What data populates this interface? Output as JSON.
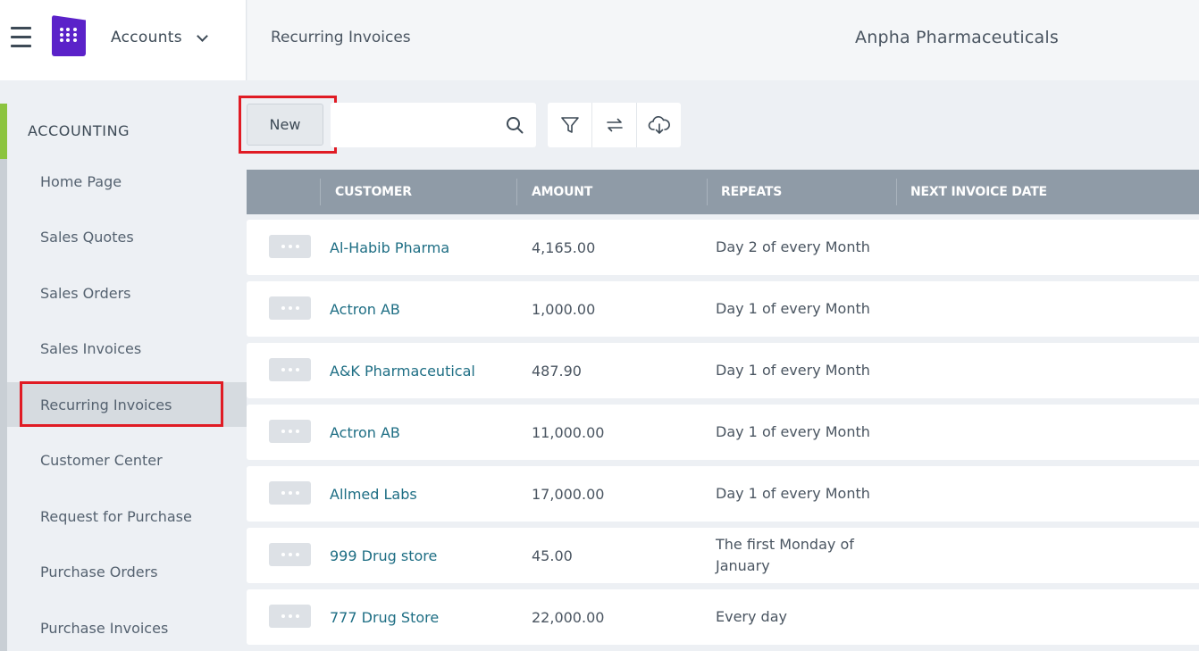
{
  "header": {
    "app_name": "Accounts",
    "page_title": "Recurring Invoices",
    "company": "Anpha Pharmaceuticals"
  },
  "sidebar": {
    "section": "ACCOUNTING",
    "items": [
      {
        "label": "Home Page"
      },
      {
        "label": "Sales Quotes"
      },
      {
        "label": "Sales Orders"
      },
      {
        "label": "Sales Invoices"
      },
      {
        "label": "Recurring Invoices",
        "active": true
      },
      {
        "label": "Customer Center"
      },
      {
        "label": "Request for Purchase"
      },
      {
        "label": "Purchase Orders"
      },
      {
        "label": "Purchase Invoices"
      }
    ]
  },
  "toolbar": {
    "new_label": "New",
    "search_placeholder": "",
    "search_value": ""
  },
  "table": {
    "columns": [
      "CUSTOMER",
      "AMOUNT",
      "REPEATS",
      "NEXT INVOICE DATE"
    ],
    "rows": [
      {
        "customer": "Al-Habib Pharma",
        "amount": "4,165.00",
        "repeats": "Day 2 of every Month",
        "next_invoice_date": ""
      },
      {
        "customer": "Actron AB",
        "amount": "1,000.00",
        "repeats": "Day 1 of every Month",
        "next_invoice_date": ""
      },
      {
        "customer": "A&K Pharmaceutical",
        "amount": "487.90",
        "repeats": "Day 1 of every Month",
        "next_invoice_date": ""
      },
      {
        "customer": "Actron AB",
        "amount": "11,000.00",
        "repeats": "Day 1 of every Month",
        "next_invoice_date": ""
      },
      {
        "customer": "Allmed Labs",
        "amount": "17,000.00",
        "repeats": "Day 1 of every Month",
        "next_invoice_date": ""
      },
      {
        "customer": "999 Drug store",
        "amount": "45.00",
        "repeats": "The first Monday of January",
        "next_invoice_date": ""
      },
      {
        "customer": "777 Drug Store",
        "amount": "22,000.00",
        "repeats": "Every day",
        "next_invoice_date": ""
      }
    ]
  },
  "colors": {
    "accent_green": "#8cc43f",
    "brand_purple": "#5b22c9",
    "highlight_red": "#e01b24",
    "link": "#1e6e84",
    "table_header": "#8f9ba7"
  },
  "icons": {
    "menu": "hamburger-icon",
    "logo": "app-logo-icon",
    "app_switch": "chevron-down-icon",
    "search": "search-icon",
    "filter": "filter-icon",
    "sync": "sync-icon",
    "download": "cloud-download-icon",
    "row_actions": "more-dots-icon"
  }
}
